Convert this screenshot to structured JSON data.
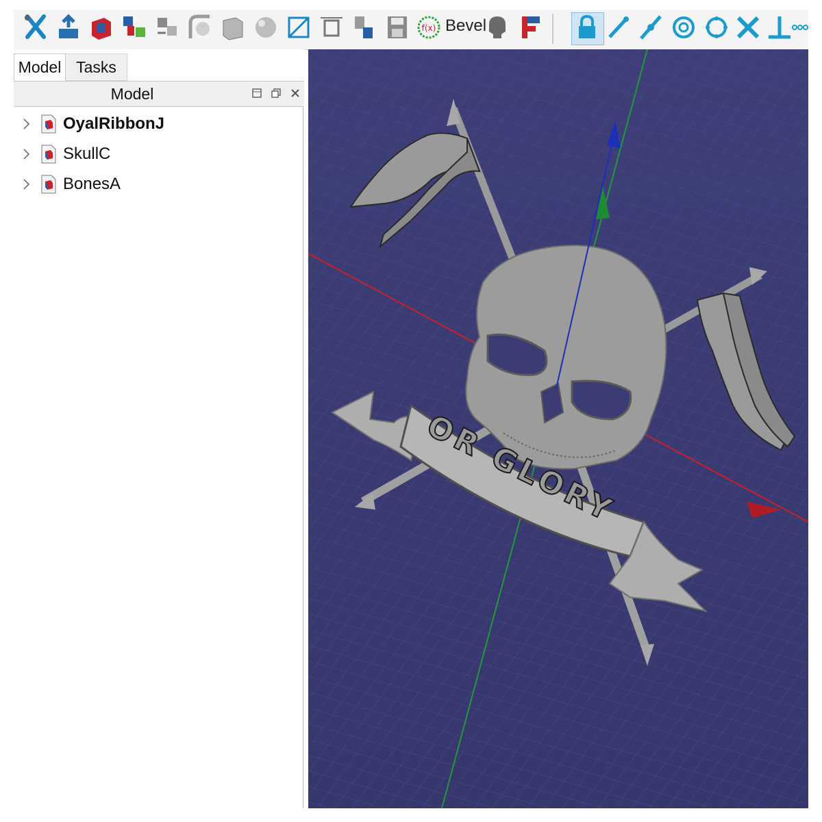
{
  "toolbar": {
    "icons": [
      "tools-icon",
      "extrude-icon",
      "pocket-icon",
      "boolean-icon",
      "part-list-icon",
      "fillet-icon",
      "box-icon",
      "sphere-icon",
      "sketch-icon",
      "dimension-icon",
      "assembly-icon",
      "save-icon",
      "formula-icon"
    ],
    "bevel_label": "Bevel",
    "icons_right": [
      "skull-tool-icon",
      "flag-icon",
      "lock-icon",
      "line-icon",
      "segment-icon",
      "circle-icon",
      "polygon-icon",
      "intersect-icon",
      "perpendicular-icon",
      "more-icon"
    ]
  },
  "left_panel": {
    "tabs": [
      {
        "label": "Model"
      },
      {
        "label": "Tasks"
      }
    ],
    "header_title": "Model",
    "tree": [
      {
        "label": "OyalRibbonJ",
        "bold": true
      },
      {
        "label": "SkullC",
        "bold": false
      },
      {
        "label": "BonesA",
        "bold": false
      }
    ]
  },
  "viewport": {
    "banner_text": "OR GLORY",
    "background_color": "#3b3c74",
    "x_axis_color": "#d0202a",
    "y_axis_color": "#1fa03a",
    "z_axis_color": "#1b2fb8",
    "model_color": "#9a9a9a"
  }
}
